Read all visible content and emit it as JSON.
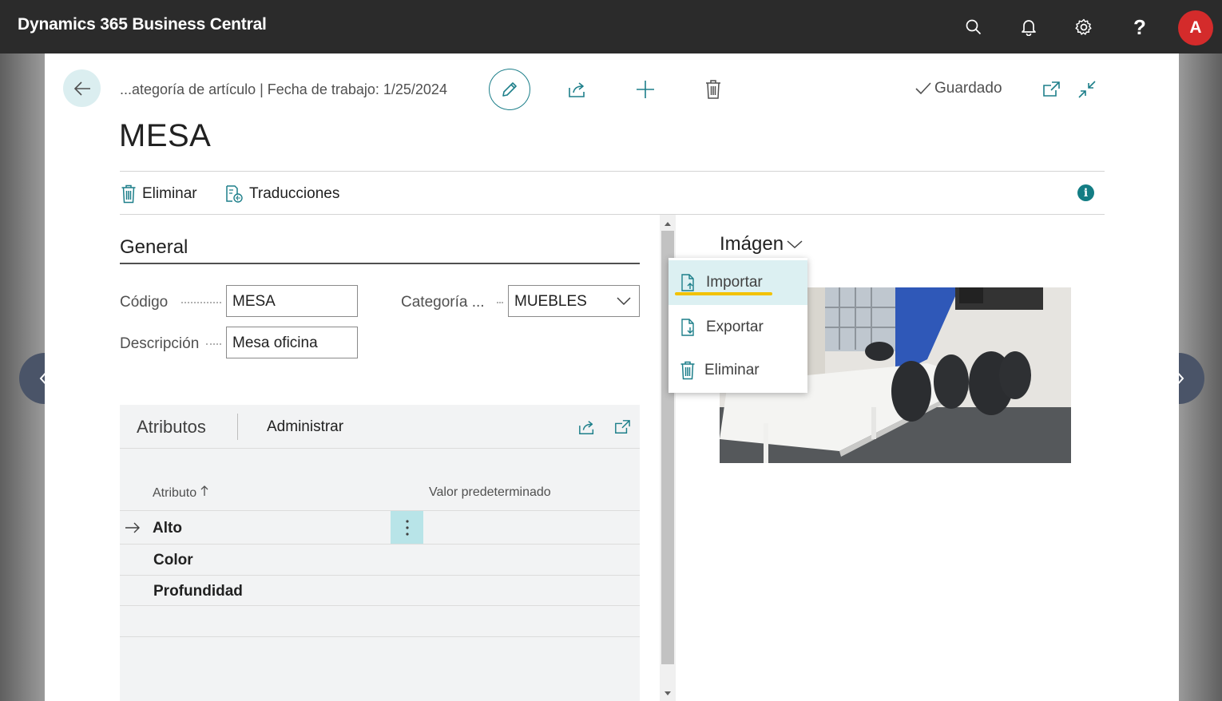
{
  "app": {
    "title": "Dynamics 365 Business Central",
    "avatar_initial": "A"
  },
  "header": {
    "breadcrumb": "...ategoría de artículo | Fecha de trabajo: 1/25/2024",
    "saved_label": "Guardado"
  },
  "page": {
    "title": "MESA"
  },
  "actions": {
    "delete_label": "Eliminar",
    "translations_label": "Traducciones"
  },
  "general": {
    "title": "General",
    "code_label": "Código",
    "code_value": "MESA",
    "description_label": "Descripción",
    "description_value": "Mesa oficina",
    "category_label": "Categoría ...",
    "category_value": "MUEBLES"
  },
  "attributes": {
    "tab_label": "Atributos",
    "manage_label": "Administrar",
    "col_attribute": "Atributo",
    "col_default_value": "Valor predeterminado",
    "rows": [
      {
        "attribute": "Alto",
        "value": ""
      },
      {
        "attribute": "Color",
        "value": ""
      },
      {
        "attribute": "Profundidad",
        "value": ""
      }
    ]
  },
  "factbox": {
    "title": "Imágen",
    "menu": [
      {
        "label": "Importar",
        "icon": "import-file-icon"
      },
      {
        "label": "Exportar",
        "icon": "export-file-icon"
      },
      {
        "label": "Eliminar",
        "icon": "trash-icon"
      }
    ]
  },
  "colors": {
    "accent": "#137d84",
    "topbar": "#2b2b2b",
    "avatar": "#d42b2b",
    "annotation": "#f2c200"
  }
}
